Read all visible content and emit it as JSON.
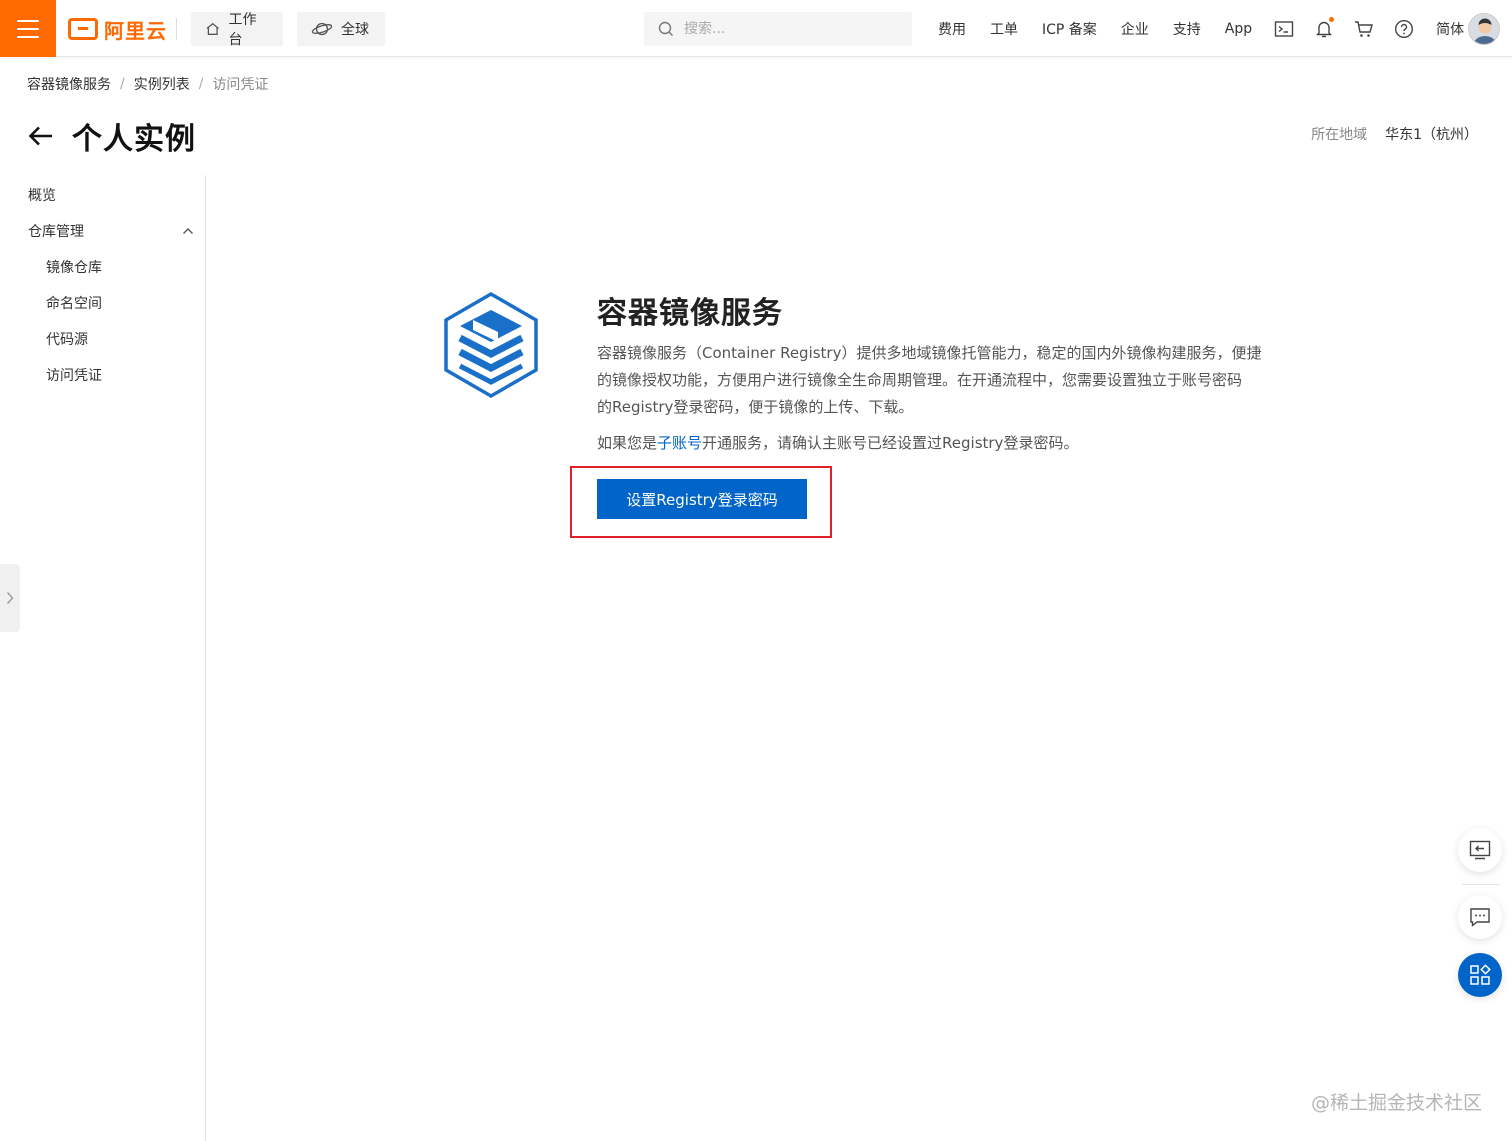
{
  "topbar": {
    "logo_text": "阿里云",
    "workbench": "工作台",
    "global": "全球",
    "search_placeholder": "搜索...",
    "links": [
      "费用",
      "工单",
      "ICP 备案",
      "企业",
      "支持",
      "App"
    ],
    "language": "简体"
  },
  "breadcrumb": [
    "容器镜像服务",
    "实例列表",
    "访问凭证"
  ],
  "page": {
    "title": "个人实例",
    "region_label": "所在地域",
    "region_value": "华东1（杭州）"
  },
  "sidebar": {
    "overview": "概览",
    "group": "仓库管理",
    "items": [
      "镜像仓库",
      "命名空间",
      "代码源",
      "访问凭证"
    ]
  },
  "main": {
    "title": "容器镜像服务",
    "desc_line1": "容器镜像服务（Container Registry）提供多地域镜像托管能力，稳定的国内外镜像构建服务，便捷",
    "desc_line2": "的镜像授权功能，方便用户进行镜像全生命周期管理。在开通流程中，您需要设置独立于账号密码",
    "desc_line3": "的Registry登录密码，便于镜像的上传、下载。",
    "note_prefix": "如果您是",
    "note_link": "子账号",
    "note_suffix": "开通服务，请确认主账号已经设置过Registry登录密码。",
    "button": "设置Registry登录密码"
  },
  "watermark": "@稀土掘金技术社区",
  "colors": {
    "brand": "#ff6a00",
    "primary": "#0064c8",
    "highlight": "#e0202a"
  }
}
